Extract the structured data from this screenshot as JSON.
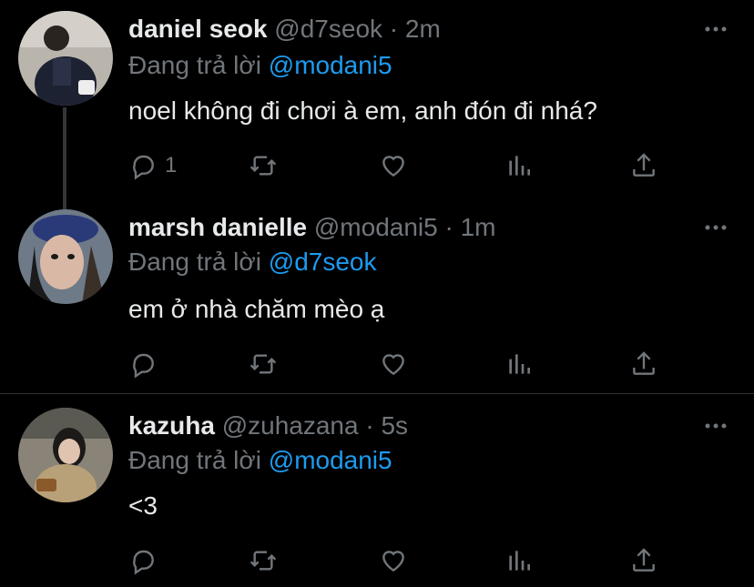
{
  "tweets": [
    {
      "name": "daniel seok",
      "handle": "@d7seok",
      "time": "2m",
      "replying_prefix": "Đang trả lời",
      "replying_to": "@modani5",
      "text": "noel không đi chơi à em, anh đón đi nhá?",
      "reply_count": "1",
      "avatar_icon": "user-photo"
    },
    {
      "name": "marsh danielle",
      "handle": "@modani5",
      "time": "1m",
      "replying_prefix": "Đang trả lời",
      "replying_to": "@d7seok",
      "text": "em ở nhà chăm mèo ạ",
      "reply_count": "",
      "avatar_icon": "user-photo"
    },
    {
      "name": "kazuha",
      "handle": "@zuhazana",
      "time": "5s",
      "replying_prefix": "Đang trả lời",
      "replying_to": "@modani5",
      "text": "<3",
      "reply_count": "",
      "avatar_icon": "user-photo"
    }
  ],
  "separator": "·",
  "colors": {
    "background": "#000000",
    "text": "#e7e9ea",
    "muted": "#71767b",
    "link": "#1d9bf0",
    "divider": "#2f3336"
  },
  "action_icons": [
    "reply-icon",
    "retweet-icon",
    "like-icon",
    "analytics-icon",
    "share-icon"
  ]
}
